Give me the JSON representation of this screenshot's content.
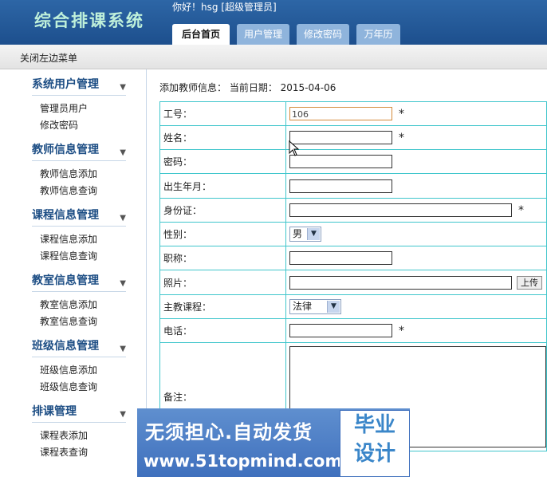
{
  "header": {
    "logo": "综合排课系统",
    "greeting": "你好！hsg [超级管理员]",
    "tabs": [
      {
        "label": "后台首页"
      },
      {
        "label": "用户管理"
      },
      {
        "label": "修改密码"
      },
      {
        "label": "万年历"
      }
    ]
  },
  "toolbar": {
    "close_menu": "关闭左边菜单"
  },
  "sidebar": {
    "sections": [
      {
        "title": "系统用户管理",
        "items": [
          "管理员用户",
          "修改密码"
        ]
      },
      {
        "title": "教师信息管理",
        "items": [
          "教师信息添加",
          "教师信息查询"
        ]
      },
      {
        "title": "课程信息管理",
        "items": [
          "课程信息添加",
          "课程信息查询"
        ]
      },
      {
        "title": "教室信息管理",
        "items": [
          "教室信息添加",
          "教室信息查询"
        ]
      },
      {
        "title": "班级信息管理",
        "items": [
          "班级信息添加",
          "班级信息查询"
        ]
      },
      {
        "title": "排课管理",
        "items": [
          "课程表添加",
          "课程表查询"
        ]
      }
    ]
  },
  "main": {
    "breadcrumb": "添加教师信息： 当前日期： 2015-04-06",
    "fields": {
      "id": {
        "label": "工号：",
        "value": "106"
      },
      "name": {
        "label": "姓名："
      },
      "password": {
        "label": "密码："
      },
      "birth": {
        "label": "出生年月："
      },
      "idcard": {
        "label": "身份证："
      },
      "gender": {
        "label": "性别：",
        "value": "男"
      },
      "title": {
        "label": "职称："
      },
      "photo": {
        "label": "照片：",
        "upload": "上传"
      },
      "course": {
        "label": "主教课程：",
        "value": "法律"
      },
      "phone": {
        "label": "电话："
      },
      "remark": {
        "label": "备注："
      }
    },
    "required_mark": "*"
  },
  "watermark": {
    "line1": "无须担心.自动发货",
    "line2": "www.51topmind.com",
    "box1": "毕业",
    "box2": "设计"
  }
}
